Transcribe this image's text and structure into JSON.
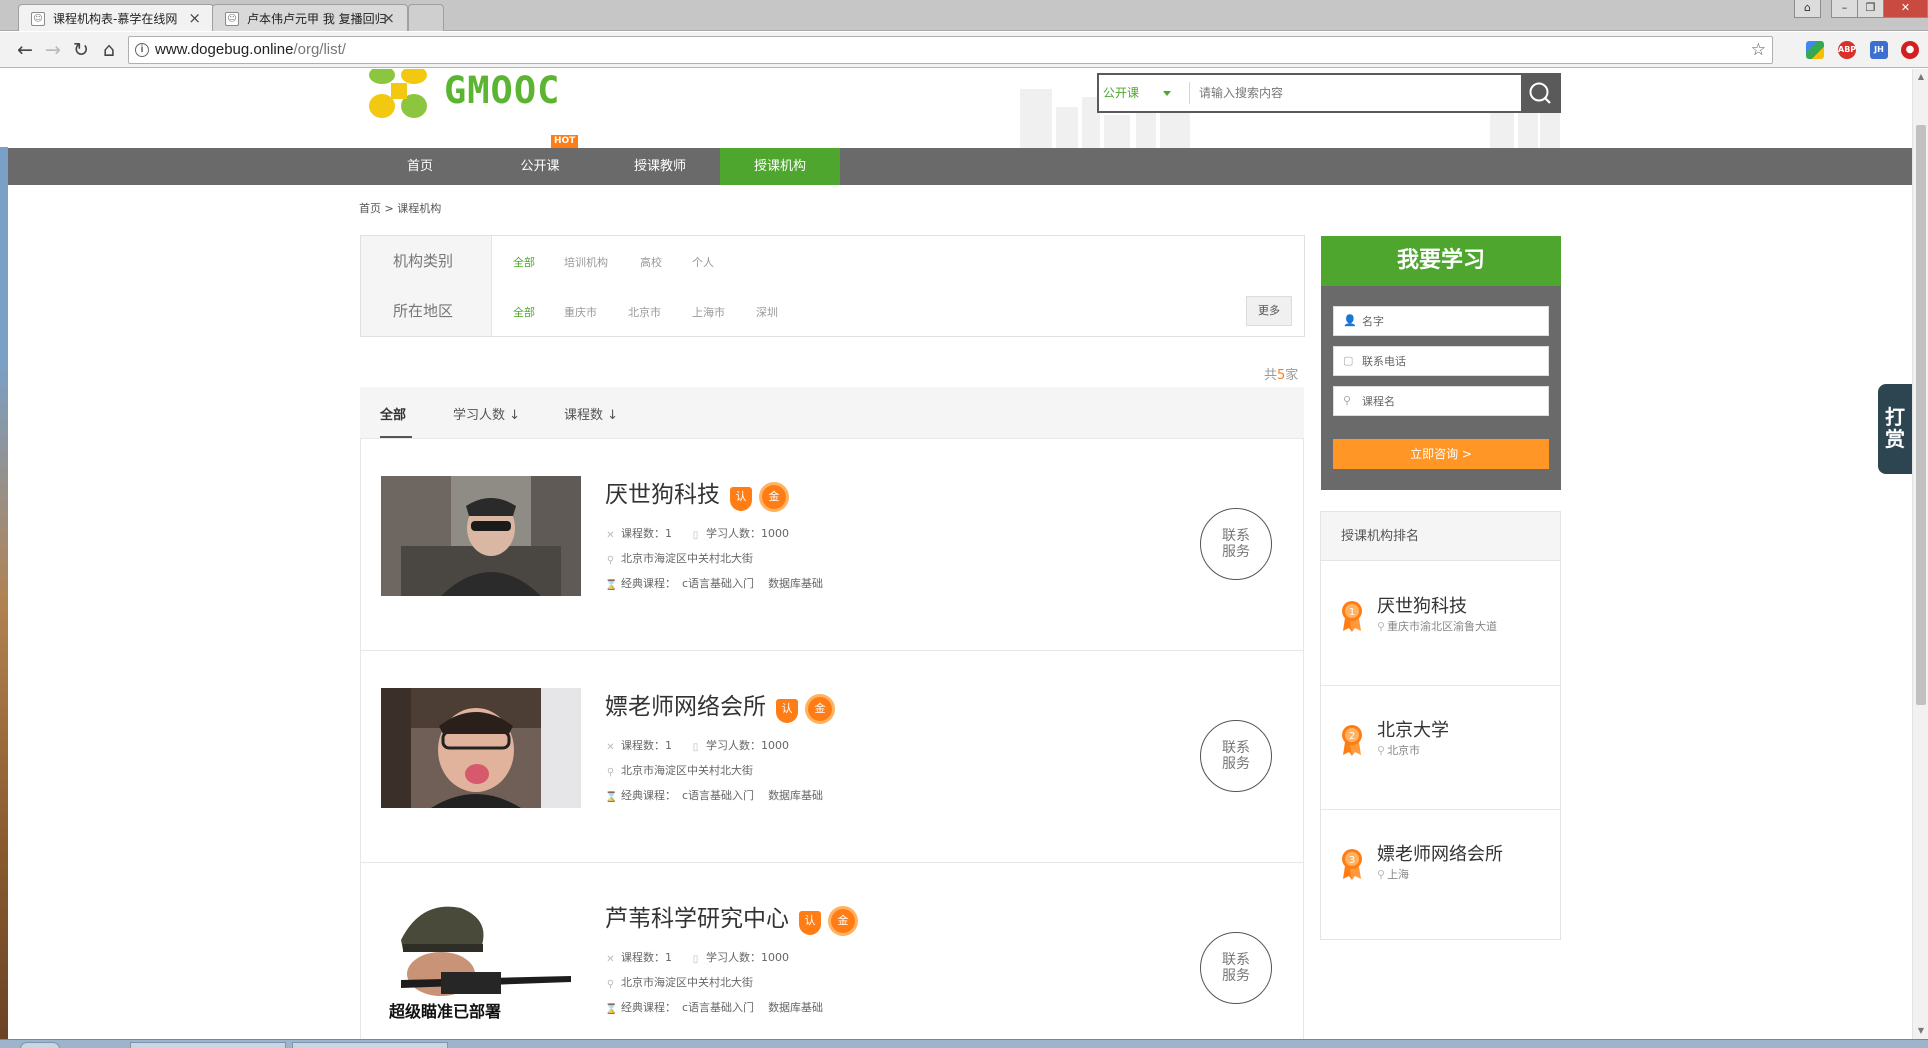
{
  "browser": {
    "tabs": [
      {
        "title": "课程机构表-慕学在线网",
        "active": true
      },
      {
        "title": "卢本伟卢元甲 我 复播回归",
        "active": false
      }
    ],
    "url_host": "www.dogebug.online",
    "url_path": "/org/list/",
    "extensions": [
      "ABP",
      "JH"
    ]
  },
  "header": {
    "logo_text": "GMOOC",
    "search": {
      "type_label": "公开课",
      "placeholder": "请输入搜索内容"
    }
  },
  "nav": {
    "hot_badge": "HOT",
    "items": [
      {
        "label": "首页"
      },
      {
        "label": "公开课"
      },
      {
        "label": "授课教师"
      },
      {
        "label": "授课机构",
        "active": true
      }
    ]
  },
  "breadcrumb": "首页 > 课程机构",
  "filter": {
    "category_label": "机构类别",
    "category_options": [
      "全部",
      "培训机构",
      "高校",
      "个人"
    ],
    "region_label": "所在地区",
    "region_options": [
      "全部",
      "重庆市",
      "北京市",
      "上海市",
      "深圳"
    ],
    "more_label": "更多"
  },
  "total": {
    "prefix": "共",
    "count": "5",
    "suffix": "家"
  },
  "sort_tabs": [
    "全部",
    "学习人数 ↓",
    "课程数 ↓"
  ],
  "orgs": [
    {
      "name": "厌世狗科技",
      "badge_ren": "认",
      "badge_jin": "金",
      "course_count_label": "课程数：1",
      "students_label": "学习人数：1000",
      "address": "北京市海淀区中关村北大街",
      "classic_label": "经典课程：",
      "classic_courses": [
        "c语言基础入门",
        "数据库基础"
      ],
      "contact_label": "联系服务"
    },
    {
      "name": "嫖老师网络会所",
      "badge_ren": "认",
      "badge_jin": "金",
      "course_count_label": "课程数：1",
      "students_label": "学习人数：1000",
      "address": "北京市海淀区中关村北大街",
      "classic_label": "经典课程：",
      "classic_courses": [
        "c语言基础入门",
        "数据库基础"
      ],
      "contact_label": "联系服务"
    },
    {
      "name": "芦苇科学研究中心",
      "badge_ren": "认",
      "badge_jin": "金",
      "course_count_label": "课程数：1",
      "students_label": "学习人数：1000",
      "address": "北京市海淀区中关村北大街",
      "classic_label": "经典课程：",
      "classic_courses": [
        "c语言基础入门",
        "数据库基础"
      ],
      "contact_label": "联系服务",
      "image_caption": "超级瞄准已部署"
    }
  ],
  "learn_form": {
    "title": "我要学习",
    "name_placeholder": "名字",
    "phone_placeholder": "联系电话",
    "course_placeholder": "课程名",
    "submit_label": "立即咨询 >"
  },
  "ranking": {
    "title": "授课机构排名",
    "items": [
      {
        "rank": "1",
        "name": "厌世狗科技",
        "address": "重庆市渝北区渝鲁大道"
      },
      {
        "rank": "2",
        "name": "北京大学",
        "address": "北京市"
      },
      {
        "rank": "3",
        "name": "嫖老师网络会所",
        "address": "上海"
      }
    ]
  },
  "reward_label": "打赏",
  "colors": {
    "brand_green": "#4fa62f",
    "accent_orange": "#ff7d14",
    "nav_gray": "#6a6a6a"
  }
}
